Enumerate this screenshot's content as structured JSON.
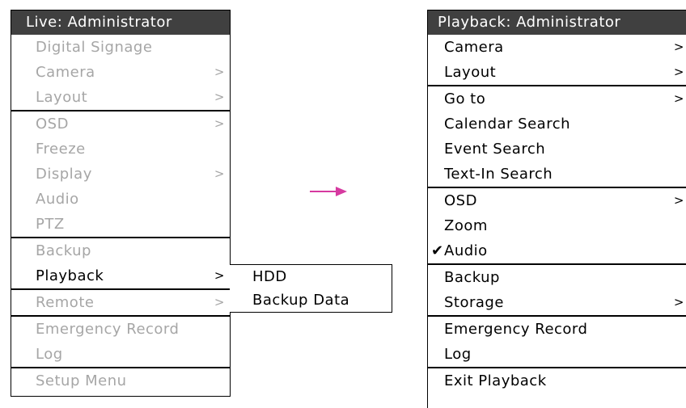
{
  "live_menu": {
    "title": "Live: Administrator",
    "sections": [
      [
        {
          "label": "Digital Signage",
          "enabled": false,
          "submenu": false
        },
        {
          "label": "Camera",
          "enabled": false,
          "submenu": true
        },
        {
          "label": "Layout",
          "enabled": false,
          "submenu": true
        }
      ],
      [
        {
          "label": "OSD",
          "enabled": false,
          "submenu": true
        },
        {
          "label": "Freeze",
          "enabled": false,
          "submenu": false
        },
        {
          "label": "Display",
          "enabled": false,
          "submenu": true
        },
        {
          "label": "Audio",
          "enabled": false,
          "submenu": false
        },
        {
          "label": "PTZ",
          "enabled": false,
          "submenu": false
        }
      ],
      [
        {
          "label": "Backup",
          "enabled": false,
          "submenu": false
        },
        {
          "label": "Playback",
          "enabled": true,
          "submenu": true
        }
      ],
      [
        {
          "label": "Remote",
          "enabled": false,
          "submenu": true
        }
      ],
      [
        {
          "label": "Emergency Record",
          "enabled": false,
          "submenu": false
        },
        {
          "label": "Log",
          "enabled": false,
          "submenu": false
        }
      ],
      [
        {
          "label": "Setup Menu",
          "enabled": false,
          "submenu": false
        }
      ]
    ]
  },
  "playback_submenu": {
    "items": [
      "HDD",
      "Backup Data"
    ]
  },
  "transition_arrow": {
    "color": "#d63aa0"
  },
  "playback_menu": {
    "title": "Playback: Administrator",
    "sections": [
      [
        {
          "label": "Camera",
          "submenu": true,
          "checked": false
        },
        {
          "label": "Layout",
          "submenu": true,
          "checked": false
        }
      ],
      [
        {
          "label": "Go to",
          "submenu": true,
          "checked": false
        },
        {
          "label": "Calendar Search",
          "submenu": false,
          "checked": false
        },
        {
          "label": "Event Search",
          "submenu": false,
          "checked": false
        },
        {
          "label": "Text-In Search",
          "submenu": false,
          "checked": false
        }
      ],
      [
        {
          "label": "OSD",
          "submenu": true,
          "checked": false
        },
        {
          "label": "Zoom",
          "submenu": false,
          "checked": false
        },
        {
          "label": "Audio",
          "submenu": false,
          "checked": true
        }
      ],
      [
        {
          "label": "Backup",
          "submenu": false,
          "checked": false
        },
        {
          "label": "Storage",
          "submenu": true,
          "checked": false
        }
      ],
      [
        {
          "label": "Emergency Record",
          "submenu": false,
          "checked": false
        },
        {
          "label": "Log",
          "submenu": false,
          "checked": false
        }
      ],
      [
        {
          "label": "Exit Playback",
          "submenu": false,
          "checked": false
        }
      ]
    ],
    "submenu_glyph": ">",
    "check_glyph": "✔"
  }
}
